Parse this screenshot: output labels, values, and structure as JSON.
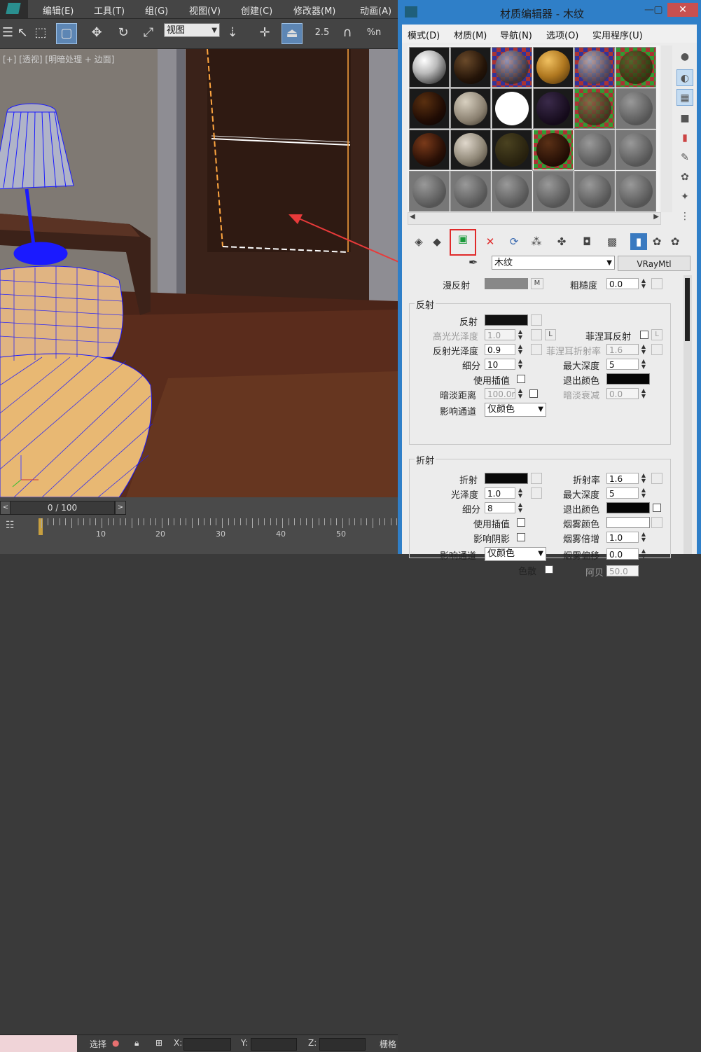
{
  "app": {
    "menus": [
      "编辑(E)",
      "工具(T)",
      "组(G)",
      "视图(V)",
      "创建(C)",
      "修改器(M)",
      "动画(A)"
    ],
    "toolbar": {
      "ref_coord": "视图",
      "snap_value": "2.5",
      "percent_label": "%n"
    }
  },
  "viewport": {
    "label": "[+] [透视] [明暗处理 + 边面]"
  },
  "timeline": {
    "frame_counter": "0 / 100",
    "ruler_labels": [
      "10",
      "20",
      "30",
      "40",
      "50"
    ],
    "status": {
      "select_label": "选择",
      "x_label": "X:",
      "y_label": "Y:",
      "z_label": "Z:",
      "grid_label": "栅格"
    }
  },
  "material_editor": {
    "title": "材质编辑器 - 木纹",
    "menus": [
      "模式(D)",
      "材质(M)",
      "导航(N)",
      "选项(O)",
      "实用程序(U)"
    ],
    "material_name": "木纹",
    "material_type": "VRayMtl",
    "diffuse": {
      "label": "漫反射",
      "map_btn": "M",
      "roughness_label": "粗糙度",
      "roughness": "0.0"
    },
    "reflection": {
      "group_title": "反射",
      "reflect_label": "反射",
      "hilight_gloss_label": "高光光泽度",
      "hilight_gloss": "1.0",
      "lock": "L",
      "fresnel_label": "菲涅耳反射",
      "fresnel_lock": "L",
      "refl_gloss_label": "反射光泽度",
      "refl_gloss": "0.9",
      "fresnel_ior_label": "菲涅耳折射率",
      "fresnel_ior": "1.6",
      "subdivs_label": "细分",
      "subdivs": "10",
      "max_depth_label": "最大深度",
      "max_depth": "5",
      "use_interp_label": "使用插值",
      "exit_color_label": "退出颜色",
      "dim_dist_label": "暗淡距离",
      "dim_dist": "100.0m",
      "dim_falloff_label": "暗淡衰减",
      "dim_falloff": "0.0",
      "affect_channels_label": "影响通道",
      "affect_channels": "仅颜色"
    },
    "refraction": {
      "group_title": "折射",
      "refract_label": "折射",
      "ior_label": "折射率",
      "ior": "1.6",
      "gloss_label": "光泽度",
      "gloss": "1.0",
      "max_depth_label": "最大深度",
      "max_depth": "5",
      "subdivs_label": "细分",
      "subdivs": "8",
      "exit_color_label": "退出颜色",
      "use_interp_label": "使用插值",
      "fog_color_label": "烟雾颜色",
      "affect_shadows_label": "影响阴影",
      "fog_mult_label": "烟雾倍增",
      "fog_mult": "1.0",
      "affect_channels_label": "影响通道",
      "affect_channels": "仅颜色",
      "fog_bias_label": "烟雾偏移",
      "fog_bias": "0.0",
      "dispersion_label": "色散",
      "abbe_label": "阿贝",
      "abbe": "50.0"
    }
  },
  "colors": {
    "accent": "#2f7fc8",
    "highlight": "#e02a2a"
  }
}
